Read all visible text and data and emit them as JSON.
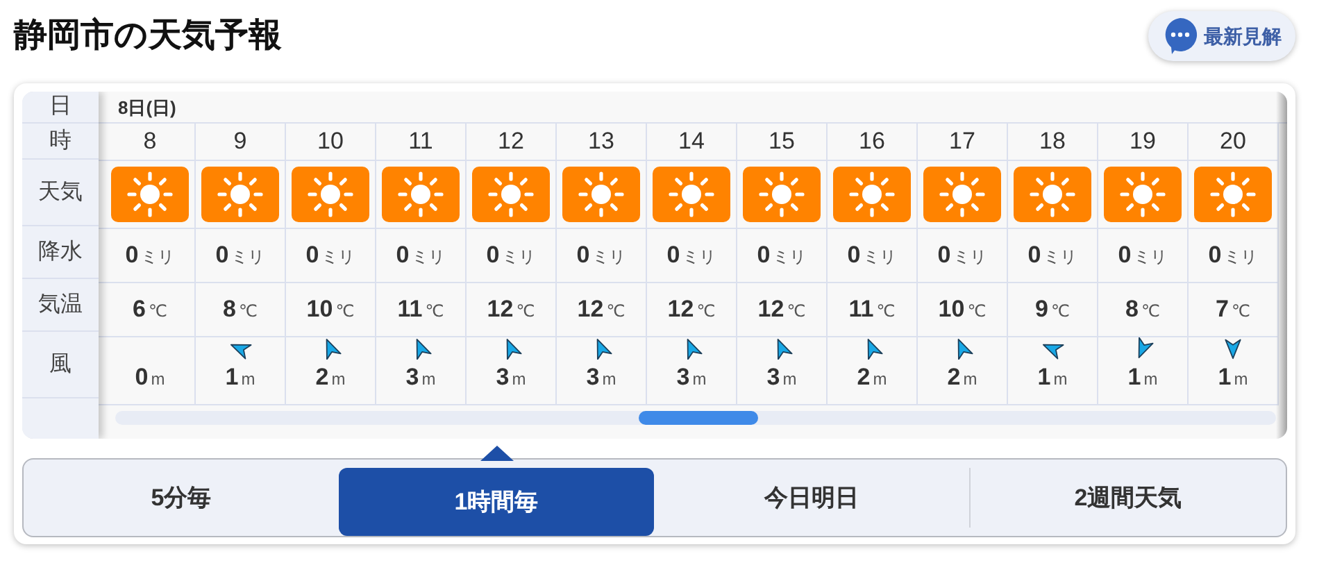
{
  "title": "静岡市の天気予報",
  "latest_button": {
    "label": "最新見解"
  },
  "row_labels": {
    "day": "日",
    "hour": "時",
    "weather": "天気",
    "precip": "降水",
    "temp": "気温",
    "wind": "風"
  },
  "day": "8日(日)",
  "hours": [
    {
      "hour": "8",
      "kind": "sunny",
      "precip": "0",
      "precip_unit": "ミリ",
      "temp": "6",
      "temp_unit": "℃",
      "wind": {
        "kind": "calm",
        "speed": "0",
        "unit": "m"
      }
    },
    {
      "hour": "9",
      "kind": "sunny",
      "precip": "0",
      "precip_unit": "ミリ",
      "temp": "8",
      "temp_unit": "℃",
      "wind": {
        "kind": "wnw",
        "speed": "1",
        "unit": "m"
      }
    },
    {
      "hour": "10",
      "kind": "sunny",
      "precip": "0",
      "precip_unit": "ミリ",
      "temp": "10",
      "temp_unit": "℃",
      "wind": {
        "kind": "nnw",
        "speed": "2",
        "unit": "m"
      }
    },
    {
      "hour": "11",
      "kind": "sunny",
      "precip": "0",
      "precip_unit": "ミリ",
      "temp": "11",
      "temp_unit": "℃",
      "wind": {
        "kind": "nnw",
        "speed": "3",
        "unit": "m"
      }
    },
    {
      "hour": "12",
      "kind": "sunny",
      "precip": "0",
      "precip_unit": "ミリ",
      "temp": "12",
      "temp_unit": "℃",
      "wind": {
        "kind": "nnw",
        "speed": "3",
        "unit": "m"
      }
    },
    {
      "hour": "13",
      "kind": "sunny",
      "precip": "0",
      "precip_unit": "ミリ",
      "temp": "12",
      "temp_unit": "℃",
      "wind": {
        "kind": "nnw",
        "speed": "3",
        "unit": "m"
      }
    },
    {
      "hour": "14",
      "kind": "sunny",
      "precip": "0",
      "precip_unit": "ミリ",
      "temp": "12",
      "temp_unit": "℃",
      "wind": {
        "kind": "nnw",
        "speed": "3",
        "unit": "m"
      }
    },
    {
      "hour": "15",
      "kind": "sunny",
      "precip": "0",
      "precip_unit": "ミリ",
      "temp": "12",
      "temp_unit": "℃",
      "wind": {
        "kind": "nnw",
        "speed": "3",
        "unit": "m"
      }
    },
    {
      "hour": "16",
      "kind": "sunny",
      "precip": "0",
      "precip_unit": "ミリ",
      "temp": "11",
      "temp_unit": "℃",
      "wind": {
        "kind": "nnw",
        "speed": "2",
        "unit": "m"
      }
    },
    {
      "hour": "17",
      "kind": "sunny",
      "precip": "0",
      "precip_unit": "ミリ",
      "temp": "10",
      "temp_unit": "℃",
      "wind": {
        "kind": "nnw",
        "speed": "2",
        "unit": "m"
      }
    },
    {
      "hour": "18",
      "kind": "sunny",
      "precip": "0",
      "precip_unit": "ミリ",
      "temp": "9",
      "temp_unit": "℃",
      "wind": {
        "kind": "wnw",
        "speed": "1",
        "unit": "m"
      }
    },
    {
      "hour": "19",
      "kind": "sunny",
      "precip": "0",
      "precip_unit": "ミリ",
      "temp": "8",
      "temp_unit": "℃",
      "wind": {
        "kind": "ssw",
        "speed": "1",
        "unit": "m"
      }
    },
    {
      "hour": "20",
      "kind": "sunny",
      "precip": "0",
      "precip_unit": "ミリ",
      "temp": "7",
      "temp_unit": "℃",
      "wind": {
        "kind": "s",
        "speed": "1",
        "unit": "m"
      }
    }
  ],
  "tabs": [
    {
      "label": "5分毎",
      "selected": false
    },
    {
      "label": "1時間毎",
      "selected": true
    },
    {
      "label": "今日明日",
      "selected": false
    },
    {
      "label": "2週間天気",
      "selected": false
    }
  ]
}
